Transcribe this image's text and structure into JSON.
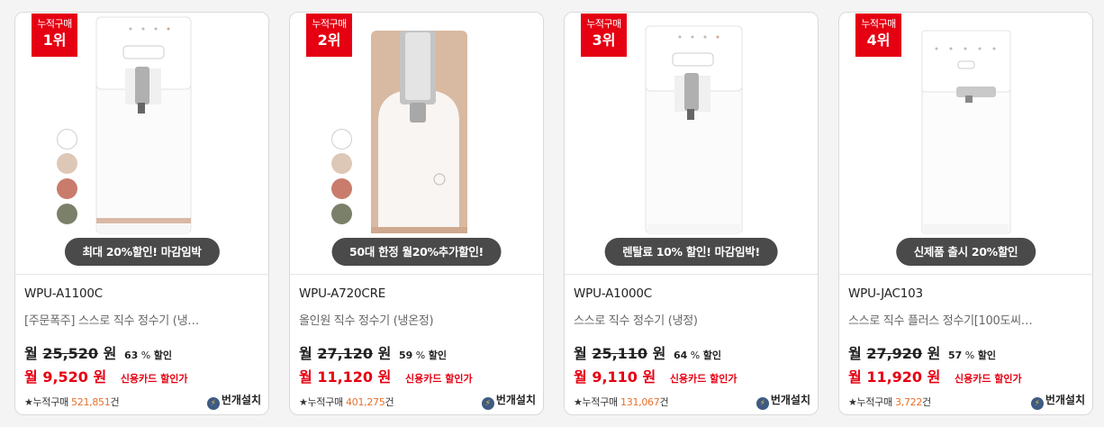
{
  "products": [
    {
      "rank_label": "누적구매",
      "rank": "1위",
      "promo": "최대 20%할인! 마감임박",
      "model": "WPU-A1100C",
      "desc": "[주문폭주] 스스로 직수 정수기 (냉…",
      "orig_prefix": "월",
      "orig_price": "25,520",
      "orig_unit": "원",
      "discount_pct": "63",
      "discount_pct_unit": "%",
      "discount_label": "할인",
      "sale_prefix": "월",
      "sale_price": "9,520",
      "sale_unit": "원",
      "card_label": "신용카드 할인가",
      "sold_label": "★누적구매",
      "sold_count": "521,851",
      "sold_unit": "건",
      "install_label": "번개설치",
      "has_swatches": true
    },
    {
      "rank_label": "누적구매",
      "rank": "2위",
      "promo": "50대 한정 월20%추가할인!",
      "model": "WPU-A720CRE",
      "desc": "올인원 직수 정수기 (냉온정)",
      "orig_prefix": "월",
      "orig_price": "27,120",
      "orig_unit": "원",
      "discount_pct": "59",
      "discount_pct_unit": "%",
      "discount_label": "할인",
      "sale_prefix": "월",
      "sale_price": "11,120",
      "sale_unit": "원",
      "card_label": "신용카드 할인가",
      "sold_label": "★누적구매",
      "sold_count": "401,275",
      "sold_unit": "건",
      "install_label": "번개설치",
      "has_swatches": true
    },
    {
      "rank_label": "누적구매",
      "rank": "3위",
      "promo": "렌탈료 10% 할인! 마감임박!",
      "model": "WPU-A1000C",
      "desc": "스스로 직수 정수기 (냉정)",
      "orig_prefix": "월",
      "orig_price": "25,110",
      "orig_unit": "원",
      "discount_pct": "64",
      "discount_pct_unit": "%",
      "discount_label": "할인",
      "sale_prefix": "월",
      "sale_price": "9,110",
      "sale_unit": "원",
      "card_label": "신용카드 할인가",
      "sold_label": "★누적구매",
      "sold_count": "131,067",
      "sold_unit": "건",
      "install_label": "번개설치",
      "has_swatches": false
    },
    {
      "rank_label": "누적구매",
      "rank": "4위",
      "promo": "신제품 출시 20%할인",
      "model": "WPU-JAC103",
      "desc": "스스로 직수 플러스 정수기[100도씨…",
      "orig_prefix": "월",
      "orig_price": "27,920",
      "orig_unit": "원",
      "discount_pct": "57",
      "discount_pct_unit": "%",
      "discount_label": "할인",
      "sale_prefix": "월",
      "sale_price": "11,920",
      "sale_unit": "원",
      "card_label": "신용카드 할인가",
      "sold_label": "★누적구매",
      "sold_count": "3,722",
      "sold_unit": "건",
      "install_label": "번개설치",
      "has_swatches": false
    }
  ],
  "colors": {
    "rank_red": "#e50012",
    "price_red": "#e50012",
    "sold_orange": "#e8702a",
    "promo_bg": "#4a4a4a"
  },
  "icons": {
    "install": "lightning-bolt-icon",
    "rank": "rank-badge"
  }
}
